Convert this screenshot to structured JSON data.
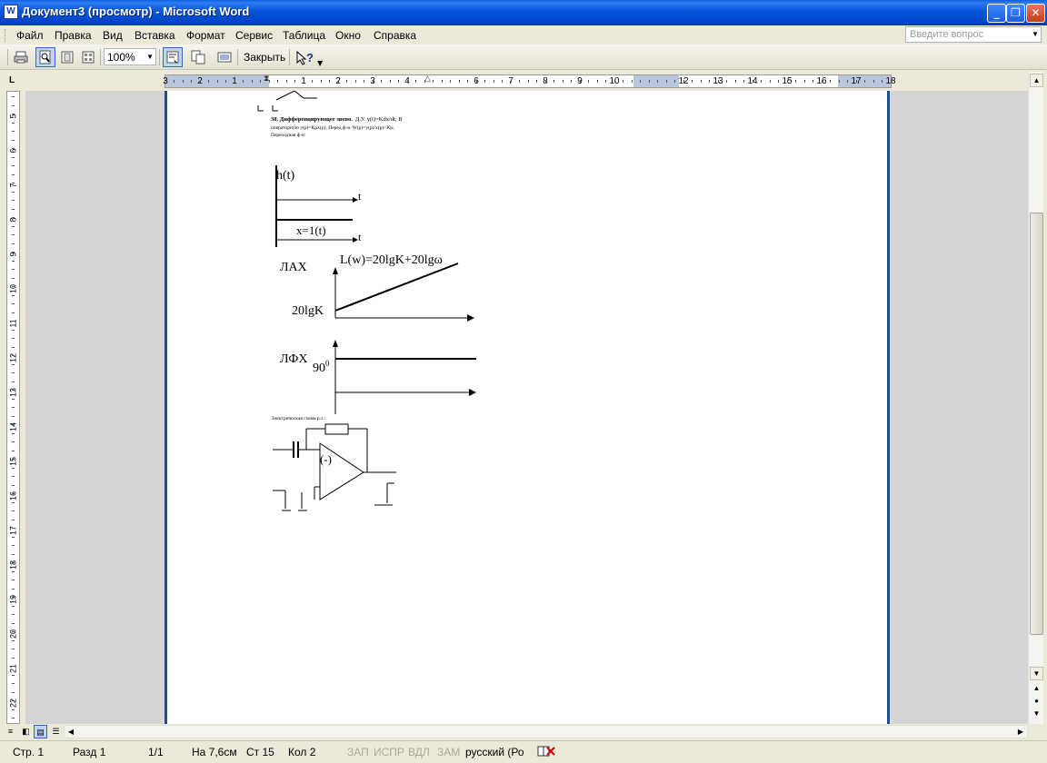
{
  "window": {
    "title": "Документ3 (просмотр) - Microsoft Word",
    "app_icon": "W"
  },
  "window_buttons": {
    "minimize": "_",
    "restore": "❐",
    "close": "✕"
  },
  "menu": [
    "Файл",
    "Правка",
    "Вид",
    "Вставка",
    "Формат",
    "Сервис",
    "Таблица",
    "Окно",
    "Справка"
  ],
  "ask_box": {
    "placeholder": "Введите вопрос"
  },
  "toolbar": {
    "zoom": "100%",
    "close_label": "Закрыть"
  },
  "ruler": {
    "corner": "L",
    "h_numbers": [
      "3",
      "2",
      "1",
      "1",
      "2",
      "3",
      "4",
      "6",
      "7",
      "8",
      "9",
      "10",
      "12",
      "13",
      "14",
      "15",
      "16",
      "17",
      "18"
    ],
    "v_numbers": [
      "5",
      "6",
      "7",
      "8",
      "9",
      "10",
      "11",
      "12",
      "13",
      "14",
      "15",
      "16",
      "17",
      "18",
      "19",
      "20",
      "21",
      "22"
    ]
  },
  "document": {
    "heading": "38. Дифференцирующее звено.",
    "heading_rest": "Д.У. y(t)=Kdx/dt; В",
    "line2": "операторную y(p)=Kpx(p); Перед.ф-я. W(p)=y(p)/x(p)=Kp;",
    "line3": "Переходная ф-я:",
    "h_label": "h(t)",
    "t_label": "t",
    "x_label": "x=1(t)",
    "t_label2": "t",
    "lax_label": "ЛАХ",
    "lax_formula": "L(w)=20lgK+20lgω",
    "lax_y": "20lgK",
    "lfx_label": "ЛФХ",
    "lfx_value": "90",
    "lfx_sup": "0",
    "scheme_caption": "Электрическая схема р.з.:",
    "opamp_sign": "(-)"
  },
  "status": {
    "page": "Стр. 1",
    "section": "Разд  1",
    "pages": "1/1",
    "at": "На  7,6см",
    "line": "Ст  15",
    "col": "Кол  2",
    "rec": "ЗАП",
    "trk": "ИСПР",
    "ext": "ВДЛ",
    "ovr": "ЗАМ",
    "language": "русский (Ро"
  },
  "colors": {
    "titlebar": "#0655D8",
    "page_border": "#1e4f8e",
    "workspace": "#d5d5d5"
  }
}
